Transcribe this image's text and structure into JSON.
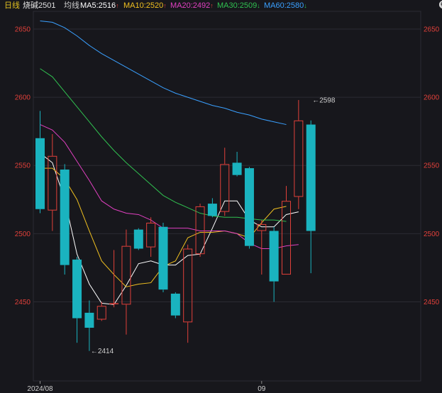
{
  "header": {
    "period": "日线",
    "symbol": "烧碱2501",
    "avg_label": "均线",
    "ma": [
      {
        "text": "MA5:2516",
        "arrow": "↑",
        "color": "#ffffff",
        "arrowColor": "#e0403a"
      },
      {
        "text": "MA10:2520",
        "arrow": "↑",
        "color": "#f0c020",
        "arrowColor": "#e0403a"
      },
      {
        "text": "MA20:2492",
        "arrow": "↑",
        "color": "#e040c0",
        "arrowColor": "#e0403a"
      },
      {
        "text": "MA30:2509",
        "arrow": "↓",
        "color": "#30c050",
        "arrowColor": "#30c050"
      },
      {
        "text": "MA60:2580",
        "arrow": "↓",
        "color": "#3aa0ff",
        "arrowColor": "#30c050"
      }
    ]
  },
  "toolbar": {
    "lock_icon": "lock-icon",
    "minus_icon": "zoom-out-icon",
    "plus_icon": "zoom-in-icon",
    "settings_icon": "settings-icon"
  },
  "colors": {
    "up": "#e0403a",
    "down": "#1ab3bf",
    "grid": "#2b2b33",
    "axis": "#e0403a"
  },
  "chart_data": {
    "type": "candlestick",
    "y_ticks": [
      2650,
      2600,
      2550,
      2500,
      2450
    ],
    "ylim": [
      2392,
      2663
    ],
    "x_labels": [
      {
        "index": 0,
        "text": "2024/08"
      },
      {
        "index": 18,
        "text": "09"
      }
    ],
    "n_slots": 23,
    "annotations": [
      {
        "index": 4,
        "value": 2414,
        "text": "2414",
        "side": "right"
      },
      {
        "index": 22,
        "value": 2598,
        "text": "2598",
        "side": "right"
      }
    ],
    "candles": [
      {
        "o": 2570,
        "h": 2590,
        "l": 2515,
        "c": 2518
      },
      {
        "o": 2517,
        "h": 2573,
        "l": 2502,
        "c": 2557
      },
      {
        "o": 2547,
        "h": 2551,
        "l": 2470,
        "c": 2477
      },
      {
        "o": 2481,
        "h": 2483,
        "l": 2420,
        "c": 2438
      },
      {
        "o": 2442,
        "h": 2451,
        "l": 2414,
        "c": 2431
      },
      {
        "o": 2437,
        "h": 2450,
        "l": 2436,
        "c": 2447
      },
      {
        "o": 2449,
        "h": 2488,
        "l": 2446,
        "c": 2449
      },
      {
        "o": 2448,
        "h": 2503,
        "l": 2426,
        "c": 2491
      },
      {
        "o": 2503,
        "h": 2504,
        "l": 2488,
        "c": 2489
      },
      {
        "o": 2490,
        "h": 2512,
        "l": 2483,
        "c": 2508
      },
      {
        "o": 2505,
        "h": 2508,
        "l": 2457,
        "c": 2459
      },
      {
        "o": 2456,
        "h": 2457,
        "l": 2438,
        "c": 2440
      },
      {
        "o": 2435,
        "h": 2492,
        "l": 2420,
        "c": 2489
      },
      {
        "o": 2485,
        "h": 2522,
        "l": 2483,
        "c": 2520
      },
      {
        "o": 2522,
        "h": 2526,
        "l": 2512,
        "c": 2513
      },
      {
        "o": 2516,
        "h": 2563,
        "l": 2513,
        "c": 2551
      },
      {
        "o": 2552,
        "h": 2560,
        "l": 2542,
        "c": 2543
      },
      {
        "o": 2548,
        "h": 2549,
        "l": 2489,
        "c": 2491
      },
      {
        "o": 2502,
        "h": 2510,
        "l": 2470,
        "c": 2507
      },
      {
        "o": 2502,
        "h": 2505,
        "l": 2450,
        "c": 2465
      },
      {
        "o": 2470,
        "h": 2535,
        "l": 2470,
        "c": 2524
      },
      {
        "o": 2527,
        "h": 2598,
        "l": 2518,
        "c": 2583
      },
      {
        "o": 2580,
        "h": 2583,
        "l": 2471,
        "c": 2502
      }
    ],
    "series": [
      {
        "name": "MA5",
        "color": "#ffffff",
        "values": [
          2559,
          2552,
          2525,
          2485,
          2463,
          2449,
          2448,
          2462,
          2478,
          2480,
          2477,
          2477,
          2484,
          2485,
          2504,
          2524,
          2524,
          2510,
          2505,
          2505,
          2514,
          2516
        ]
      },
      {
        "name": "MA10",
        "color": "#f0c020",
        "values": [
          2548,
          2548,
          2540,
          2525,
          2502,
          2480,
          2470,
          2461,
          2463,
          2464,
          2476,
          2480,
          2497,
          2501,
          2501,
          2502,
          2500,
          2497,
          2508,
          2518,
          2520
        ]
      },
      {
        "name": "MA20",
        "color": "#e040c0",
        "values": [
          2580,
          2576,
          2567,
          2553,
          2539,
          2524,
          2518,
          2515,
          2514,
          2510,
          2504,
          2504,
          2504,
          2502,
          2502,
          2502,
          2500,
          2493,
          2489,
          2489,
          2491,
          2492
        ]
      },
      {
        "name": "MA30",
        "color": "#30c050",
        "values": [
          2621,
          2615,
          2604,
          2593,
          2582,
          2571,
          2561,
          2552,
          2544,
          2536,
          2528,
          2523,
          2519,
          2515,
          2513,
          2512,
          2512,
          2511,
          2510,
          2510,
          2509
        ]
      },
      {
        "name": "MA60",
        "color": "#3aa0ff",
        "values": [
          2656,
          2655,
          2651,
          2645,
          2638,
          2632,
          2627,
          2622,
          2617,
          2612,
          2607,
          2603,
          2600,
          2597,
          2594,
          2592,
          2589,
          2587,
          2584,
          2582,
          2580
        ]
      }
    ]
  }
}
